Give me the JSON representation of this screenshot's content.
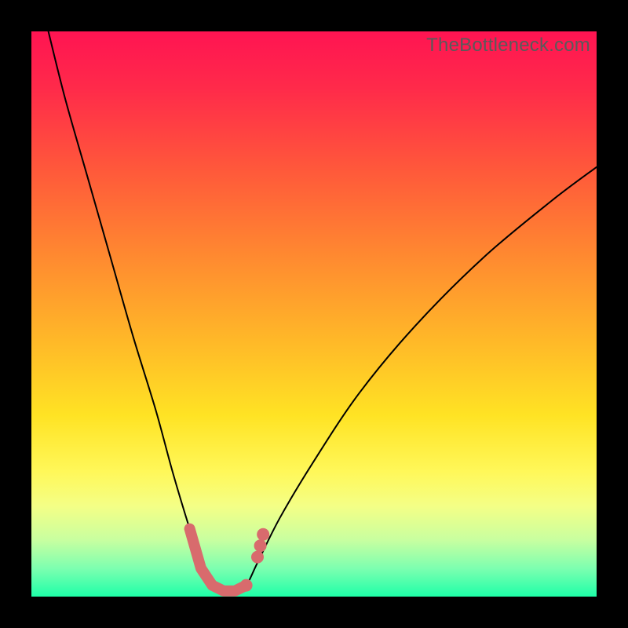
{
  "watermark": "TheBottleneck.com",
  "colors": {
    "background_frame": "#000000",
    "curve_stroke": "#000000",
    "marker_color": "#d86b6d",
    "gradient_top": "#ff1452",
    "gradient_bottom": "#1effa8"
  },
  "chart_data": {
    "type": "line",
    "title": "",
    "xlabel": "",
    "ylabel": "",
    "xlim": [
      0,
      100
    ],
    "ylim": [
      0,
      100
    ],
    "grid": false,
    "legend": false,
    "_note": "Bottleneck-style V-shaped curve on heat gradient. Axes are unlabeled; values estimated from pixel positions. y≈0 is optimal (green), y≈100 is worst (red). Minimum (bottleneck-free zone) around x≈31–38. Marker highlights the trough region.",
    "series": [
      {
        "name": "bottleneck-curve",
        "x": [
          3,
          6,
          10,
          14,
          18,
          22,
          25,
          28,
          30,
          32,
          34,
          36,
          38,
          40,
          44,
          50,
          58,
          68,
          80,
          92,
          100
        ],
        "y": [
          100,
          88,
          74,
          60,
          46,
          33,
          22,
          12,
          6,
          2,
          1,
          1,
          2,
          6,
          14,
          24,
          36,
          48,
          60,
          70,
          76
        ]
      }
    ],
    "markers": {
      "name": "highlight-trough",
      "x": [
        28,
        30,
        32,
        34,
        36,
        38,
        40,
        41
      ],
      "y": [
        12,
        5,
        2,
        1,
        1,
        2,
        7,
        11
      ]
    }
  }
}
